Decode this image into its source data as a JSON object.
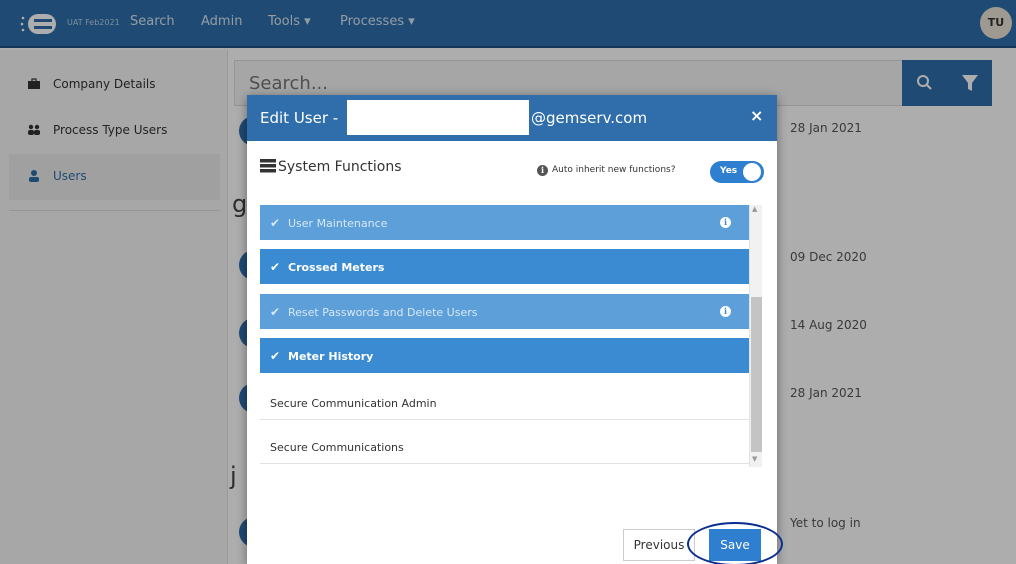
{
  "nav": {
    "env": "UAT Feb2021",
    "items": [
      "Search",
      "Admin",
      "Tools ▾",
      "Processes ▾"
    ],
    "avatar": "TU"
  },
  "sidebar": {
    "items": [
      {
        "label": "Company Details",
        "icon": "briefcase-icon"
      },
      {
        "label": "Process Type Users",
        "icon": "users-icon"
      },
      {
        "label": "Users",
        "icon": "user-icon",
        "active": true
      }
    ]
  },
  "main": {
    "search_placeholder": "Search...",
    "dates": [
      "28 Jan 2021",
      "09 Dec 2020",
      "14 Aug 2020",
      "28 Jan 2021",
      "Yet to log in"
    ],
    "letters": [
      "g",
      "j"
    ]
  },
  "modal": {
    "title_prefix": "Edit User -",
    "title_suffix": "@gemserv.com",
    "close": "×",
    "section_title": "System Functions",
    "auto_inherit_label": "Auto inherit new functions?",
    "auto_inherit_value": "Yes",
    "functions": [
      {
        "label": "User Maintenance",
        "state": "selected-inherited",
        "info": true
      },
      {
        "label": "Crossed Meters",
        "state": "selected",
        "info": false
      },
      {
        "label": "Reset Passwords and Delete Users",
        "state": "selected-inherited",
        "info": true
      },
      {
        "label": "Meter History",
        "state": "selected",
        "info": false
      },
      {
        "label": "Secure Communication Admin",
        "state": "unselected",
        "info": false
      },
      {
        "label": "Secure Communications",
        "state": "unselected",
        "info": false
      }
    ],
    "previous_label": "Previous",
    "save_label": "Save"
  },
  "colors": {
    "primary": "#2f6eab",
    "selected_row": "#3b8bd2",
    "inherited_row": "#5d9fd9",
    "annotation_ring": "#0b2f8f"
  }
}
